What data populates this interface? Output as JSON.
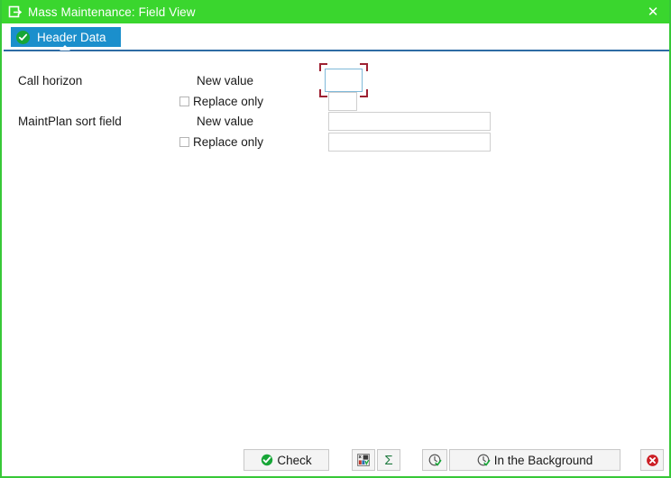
{
  "window": {
    "title": "Mass Maintenance: Field View",
    "icon": "window-menu-icon",
    "close_label": "✕",
    "accent_green": "#3ad62e",
    "tab_blue": "#1b8fcc",
    "underline_blue": "#2e6ca4"
  },
  "tabs": [
    {
      "label": "Header Data",
      "status_icon": "check-circle-icon",
      "selected": true
    }
  ],
  "form": {
    "groups": [
      {
        "label": "Call horizon",
        "new_value": {
          "caption": "New value",
          "value": "",
          "placeholder": "",
          "focused": true
        },
        "replace_only": {
          "caption": "Replace only",
          "checked": false,
          "value": "",
          "placeholder": ""
        }
      },
      {
        "label": "MaintPlan sort field",
        "new_value": {
          "caption": "New value",
          "value": "",
          "placeholder": "",
          "focused": false
        },
        "replace_only": {
          "caption": "Replace only",
          "checked": false,
          "value": "",
          "placeholder": ""
        }
      }
    ]
  },
  "toolbar": {
    "check_label": "Check",
    "check_icon": "check-circle-icon",
    "selection_icon": "selection-grid-icon",
    "sum_label": "Σ",
    "sum_icon": "sigma-icon",
    "execute_icon": "clock-check-icon",
    "background_label": "In the Background",
    "background_icon": "clock-check-icon",
    "cancel_icon": "cancel-circle-icon"
  }
}
